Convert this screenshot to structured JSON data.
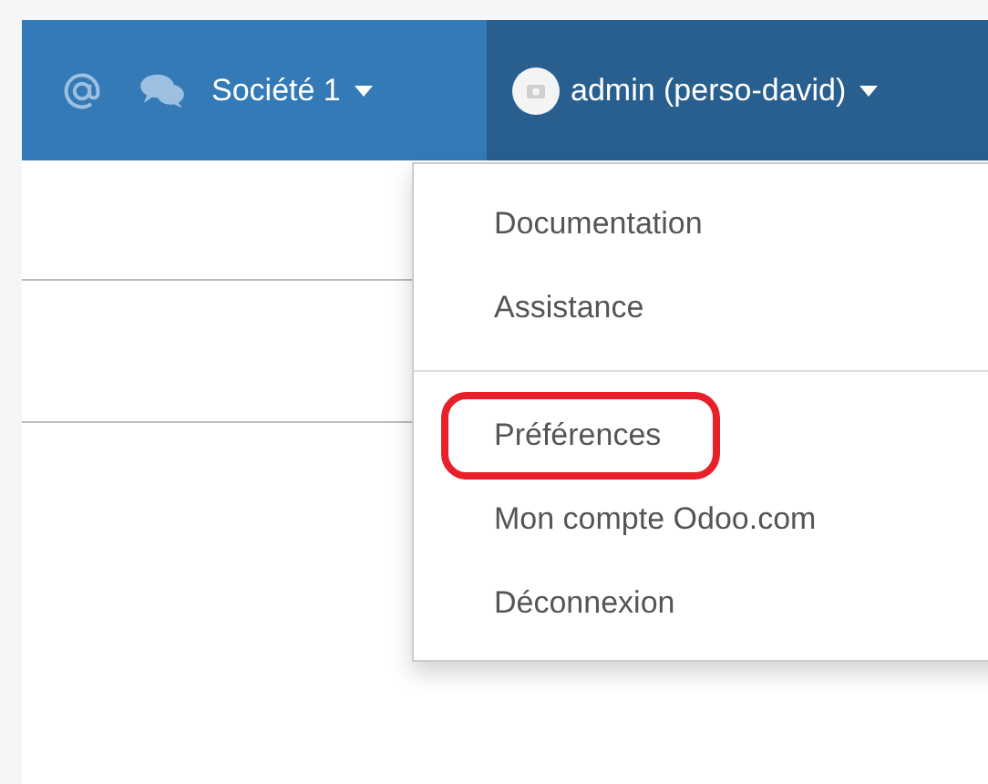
{
  "navbar": {
    "company": "Société 1",
    "user": "admin (perso-david)"
  },
  "user_menu": {
    "items": [
      {
        "kind": "item",
        "label": "Documentation",
        "highlighted": false
      },
      {
        "kind": "item",
        "label": "Assistance",
        "highlighted": false
      },
      {
        "kind": "divider"
      },
      {
        "kind": "item",
        "label": "Préférences",
        "highlighted": true
      },
      {
        "kind": "item",
        "label": "Mon compte Odoo.com",
        "highlighted": false
      },
      {
        "kind": "item",
        "label": "Déconnexion",
        "highlighted": false
      }
    ]
  }
}
